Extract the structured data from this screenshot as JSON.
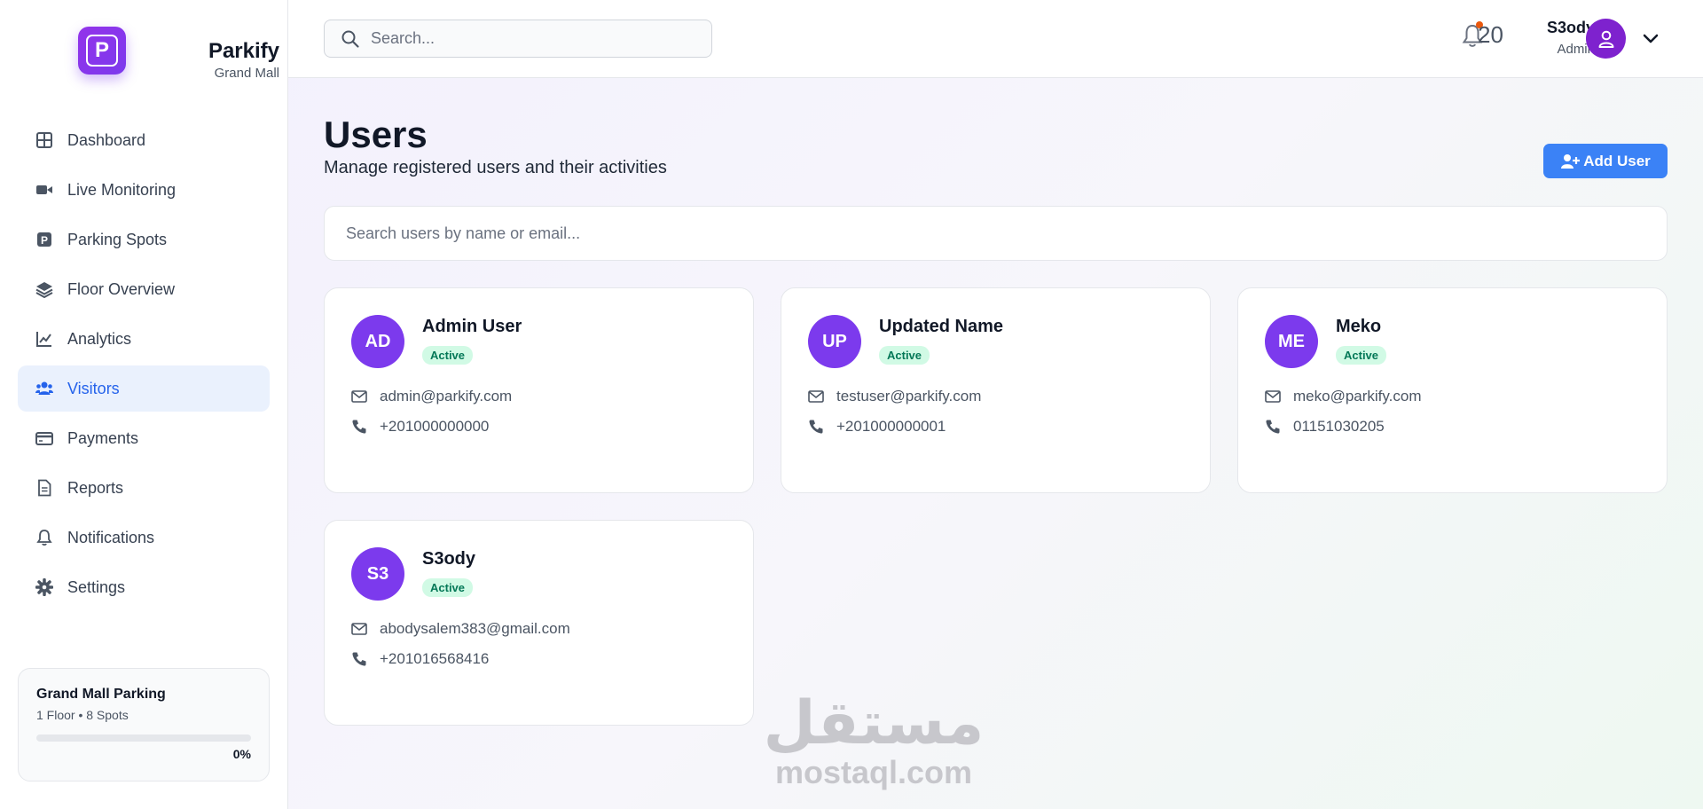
{
  "brand": {
    "logo_letter": "P",
    "name": "Parkify",
    "subtitle": "Grand Mall",
    "accent_color": "#7c3aed"
  },
  "sidebar": {
    "items": [
      {
        "label": "Dashboard",
        "icon": "grid-icon",
        "active": false
      },
      {
        "label": "Live Monitoring",
        "icon": "video-camera-icon",
        "active": false
      },
      {
        "label": "Parking Spots",
        "icon": "parking-icon",
        "active": false
      },
      {
        "label": "Floor Overview",
        "icon": "layers-icon",
        "active": false
      },
      {
        "label": "Analytics",
        "icon": "line-chart-icon",
        "active": false
      },
      {
        "label": "Visitors",
        "icon": "users-icon",
        "active": true
      },
      {
        "label": "Payments",
        "icon": "credit-card-icon",
        "active": false
      },
      {
        "label": "Reports",
        "icon": "document-icon",
        "active": false
      },
      {
        "label": "Notifications",
        "icon": "bell-icon",
        "active": false
      },
      {
        "label": "Settings",
        "icon": "gear-icon",
        "active": false
      }
    ],
    "facility": {
      "name": "Grand Mall Parking",
      "meta": "1 Floor • 8 Spots",
      "progress_percent": 0,
      "progress_label": "0%"
    }
  },
  "header": {
    "search_placeholder": "Search...",
    "notification_count": "20",
    "user_name": "S3ody",
    "user_role": "Admin"
  },
  "page": {
    "title": "Users",
    "subtitle": "Manage registered users and their activities",
    "add_user_label": "Add User",
    "search_placeholder": "Search users by name or email..."
  },
  "users": [
    {
      "initials": "AD",
      "name": "Admin User",
      "status": "Active",
      "email": "admin@parkify.com",
      "phone": "+201000000000"
    },
    {
      "initials": "UP",
      "name": "Updated Name",
      "status": "Active",
      "email": "testuser@parkify.com",
      "phone": "+201000000001"
    },
    {
      "initials": "ME",
      "name": "Meko",
      "status": "Active",
      "email": "meko@parkify.com",
      "phone": "01151030205"
    },
    {
      "initials": "S3",
      "name": "S3ody",
      "status": "Active",
      "email": "abodysalem383@gmail.com",
      "phone": "+201016568416"
    }
  ],
  "watermark": {
    "arabic": "مستقل",
    "latin": "mostaql.com"
  },
  "colors": {
    "primary_blue": "#3b82f6",
    "active_nav_bg": "#eaf1fd",
    "avatar_purple": "#7c3aed",
    "badge_green_bg": "#d1fae5",
    "badge_green_text": "#047857"
  }
}
